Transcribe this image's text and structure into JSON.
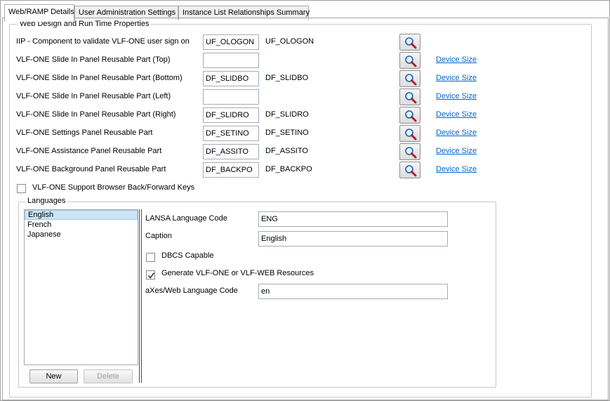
{
  "tabs": [
    {
      "label": "Web/RAMP Details",
      "active": true
    },
    {
      "label": "User Administration Settings",
      "active": false
    },
    {
      "label": "Instance List Relationships Summary",
      "active": false
    }
  ],
  "properties_group": {
    "legend": "Web Design and Run Time Properties",
    "rows": [
      {
        "label": "IIP - Component to validate VLF-ONE user sign on",
        "value": "UF_OLOGON",
        "desc": "UF_OLOGON",
        "link": ""
      },
      {
        "label": "VLF-ONE Slide In Panel Reusable Part (Top)",
        "value": "",
        "desc": "",
        "link": "Device Size"
      },
      {
        "label": "VLF-ONE Slide In Panel Reusable Part (Bottom)",
        "value": "DF_SLIDBO",
        "desc": "DF_SLIDBO",
        "link": "Device Size"
      },
      {
        "label": "VLF-ONE Slide In Panel Reusable Part (Left)",
        "value": "",
        "desc": "",
        "link": "Device Size"
      },
      {
        "label": "VLF-ONE Slide In Panel Reusable Part (Right)",
        "value": "DF_SLIDRO",
        "desc": "DF_SLIDRO",
        "link": "Device Size"
      },
      {
        "label": "VLF-ONE Settings Panel Reusable Part",
        "value": "DF_SETINO",
        "desc": "DF_SETINO",
        "link": "Device Size"
      },
      {
        "label": "VLF-ONE Assistance Panel Reusable Part",
        "value": "DF_ASSITO",
        "desc": "DF_ASSITO",
        "link": "Device Size"
      },
      {
        "label": "VLF-ONE Background Panel Reusable Part",
        "value": "DF_BACKPO",
        "desc": "DF_BACKPO",
        "link": "Device Size"
      }
    ],
    "browser_keys": {
      "label": "VLF-ONE Support Browser Back/Forward Keys",
      "checked": false
    }
  },
  "languages_group": {
    "legend": "Languages",
    "items": [
      "English",
      "French",
      "Japanese"
    ],
    "selected_index": 0,
    "new_label": "New",
    "delete_label": "Delete",
    "details": {
      "lansa_code_label": "LANSA Language Code",
      "lansa_code_value": "ENG",
      "caption_label": "Caption",
      "caption_value": "English",
      "dbcs_label": "DBCS Capable",
      "dbcs_checked": false,
      "generate_label": "Generate VLF-ONE or VLF-WEB Resources",
      "generate_checked": true,
      "axes_code_label": "aXes/Web Language Code",
      "axes_code_value": "en"
    }
  },
  "icons": {
    "prompt": "magnifier-icon",
    "check": "checkmark-icon"
  },
  "colors": {
    "link": "#0066cc",
    "selection": "#cce4f7"
  }
}
